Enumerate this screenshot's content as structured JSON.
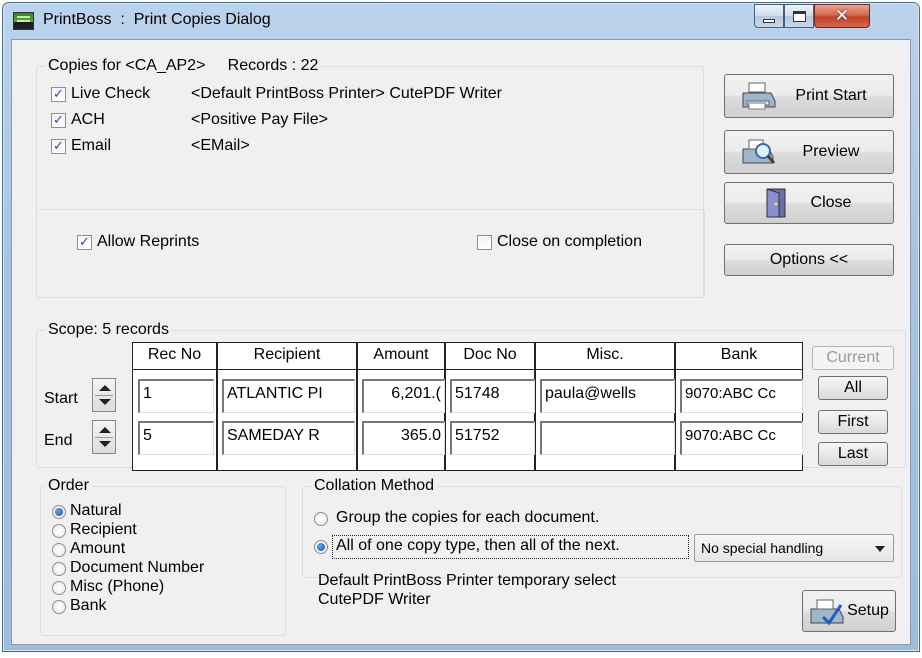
{
  "window": {
    "title": "PrintBoss  :  Print Copies Dialog"
  },
  "copies": {
    "legend": "Copies for <CA_AP2>     Records : 22",
    "items": [
      {
        "label": "Live Check",
        "destination": "<Default PrintBoss Printer> CutePDF Writer",
        "checked": true
      },
      {
        "label": "ACH",
        "destination": "<Positive Pay File>",
        "checked": true
      },
      {
        "label": "Email",
        "destination": "<EMail>",
        "checked": true
      }
    ],
    "allow_reprints": {
      "label": "Allow Reprints",
      "checked": true
    },
    "close_on_completion": {
      "label": "Close on completion",
      "checked": false
    }
  },
  "buttons": {
    "print_start": "Print Start",
    "preview": "Preview",
    "close": "Close",
    "options": "Options <<",
    "setup": "Setup"
  },
  "scope": {
    "legend": "Scope: 5 records",
    "columns": [
      "Rec No",
      "Recipient",
      "Amount",
      "Doc No",
      "Misc.",
      "Bank"
    ],
    "rows": [
      {
        "label": "Start",
        "cells": [
          "1",
          "ATLANTIC PI",
          "6,201.(",
          "51748",
          "paula@wells",
          "9070:ABC Cc"
        ]
      },
      {
        "label": "End",
        "cells": [
          "5",
          "SAMEDAY R",
          "365.0",
          "51752",
          "",
          "9070:ABC Cc"
        ]
      }
    ],
    "side_buttons": {
      "current": "Current",
      "all": "All",
      "first": "First",
      "last": "Last"
    }
  },
  "order": {
    "legend": "Order",
    "options": [
      {
        "label": "Natural",
        "selected": true
      },
      {
        "label": "Recipient",
        "selected": false
      },
      {
        "label": "Amount",
        "selected": false
      },
      {
        "label": "Document Number",
        "selected": false
      },
      {
        "label": "Misc (Phone)",
        "selected": false
      },
      {
        "label": "Bank",
        "selected": false
      }
    ]
  },
  "collation": {
    "legend": "Collation Method",
    "options": [
      {
        "label": "Group the copies for each document.",
        "selected": false
      },
      {
        "label": "All of one copy type, then all of the next.",
        "selected": true
      }
    ],
    "special_handling": "No special handling"
  },
  "printer": {
    "line1": "Default PrintBoss Printer temporary select",
    "line2": "CutePDF Writer"
  }
}
